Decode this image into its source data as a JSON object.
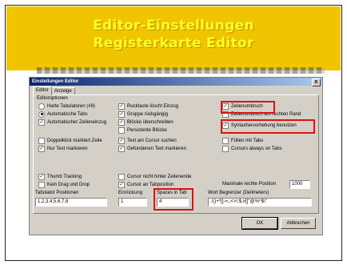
{
  "slide": {
    "title_line1": "Editor-Einstellungen",
    "title_line2": "Registerkarte Editor"
  },
  "dialog": {
    "title": "Einstellungen Editor",
    "close_glyph": "x",
    "tabs": [
      "Editor",
      "Anzeige"
    ],
    "group_label": "Editoroptionen",
    "options": {
      "harte_tab": {
        "label": "Harte Tabulatoren (#9)",
        "checked": false
      },
      "auto_tabs": {
        "label": "Automatische Tabs",
        "checked": true
      },
      "auto_indent": {
        "label": "Automatischer Zeileneinzug",
        "checked": true
      },
      "dblclick": {
        "label": "Doppelklick markiert Zeile",
        "checked": false
      },
      "nur_text": {
        "label": "Nur Text markieren",
        "checked": true
      },
      "thumb": {
        "label": "Thumb Tracking",
        "checked": true
      },
      "kein_drag": {
        "label": "Kein Drag und Drop",
        "checked": false
      },
      "rueck": {
        "label": "Rucktaste löscht Einzug",
        "checked": true
      },
      "gruppe": {
        "label": "Gruppe rückgängig",
        "checked": true
      },
      "bloecke": {
        "label": "Blöcke überschreiben",
        "checked": true
      },
      "persistent": {
        "label": "Persistente Blöcke",
        "checked": false
      },
      "cursor_suchen": {
        "label": "Text am Cursor suchen",
        "checked": true
      },
      "gefunden": {
        "label": "Gefundenen Text markieren",
        "checked": true
      },
      "cursor_nicht": {
        "label": "Cursor nicht hinter Zeilenende",
        "checked": false
      },
      "cursor_tab": {
        "label": "Cursor an Tabposition",
        "checked": true
      },
      "zeilenumbruch": {
        "label": "Zeilenumbruch",
        "checked": true
      },
      "zeilenumbruch_rand": {
        "label": "Zeilenumbruch am rechten Rand",
        "checked": false
      },
      "syntax": {
        "label": "Syntaxhervorhebung benutzen",
        "checked": true
      },
      "fuellen": {
        "label": "Füllen mit Tabs",
        "checked": false
      },
      "cursor_tabs": {
        "label": "Cursors always on Tabs",
        "checked": false
      }
    },
    "maxpos_label": "Maximale rechte Position",
    "maxpos_value": "1000",
    "fields": {
      "tab_pos_label": "Tabulator Positionen",
      "tab_pos_value": "1,2,3,4,5,6,7,8",
      "einrueck_label": "Einrückung",
      "einrueck_value": "1",
      "spaces_label": "Spaces in Tab",
      "spaces_value": "4",
      "wort_label": "Wort Begrenzer (Delimeters)",
      "wort_value": "./()+*[]-=,;<>!.$,#[]\"@%^$\\\""
    },
    "buttons": {
      "ok": "OK",
      "cancel": "Abbrechen"
    }
  },
  "colors": {
    "slide_header": "#f1c400",
    "title_text": "#ffff22",
    "highlight": "#e01010"
  }
}
